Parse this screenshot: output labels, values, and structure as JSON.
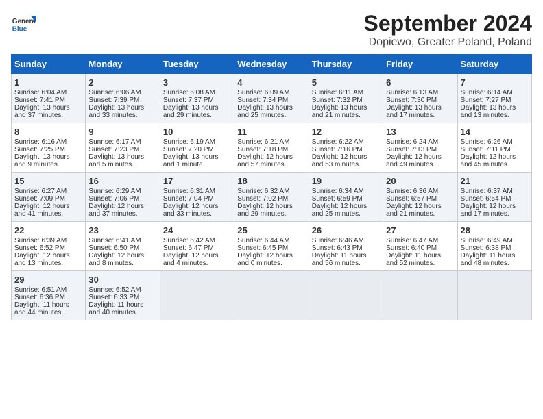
{
  "logo": {
    "general": "General",
    "blue": "Blue"
  },
  "title": "September 2024",
  "subtitle": "Dopiewo, Greater Poland, Poland",
  "weekdays": [
    "Sunday",
    "Monday",
    "Tuesday",
    "Wednesday",
    "Thursday",
    "Friday",
    "Saturday"
  ],
  "weeks": [
    [
      {
        "day": 1,
        "lines": [
          "Sunrise: 6:04 AM",
          "Sunset: 7:41 PM",
          "Daylight: 13 hours",
          "and 37 minutes."
        ]
      },
      {
        "day": 2,
        "lines": [
          "Sunrise: 6:06 AM",
          "Sunset: 7:39 PM",
          "Daylight: 13 hours",
          "and 33 minutes."
        ]
      },
      {
        "day": 3,
        "lines": [
          "Sunrise: 6:08 AM",
          "Sunset: 7:37 PM",
          "Daylight: 13 hours",
          "and 29 minutes."
        ]
      },
      {
        "day": 4,
        "lines": [
          "Sunrise: 6:09 AM",
          "Sunset: 7:34 PM",
          "Daylight: 13 hours",
          "and 25 minutes."
        ]
      },
      {
        "day": 5,
        "lines": [
          "Sunrise: 6:11 AM",
          "Sunset: 7:32 PM",
          "Daylight: 13 hours",
          "and 21 minutes."
        ]
      },
      {
        "day": 6,
        "lines": [
          "Sunrise: 6:13 AM",
          "Sunset: 7:30 PM",
          "Daylight: 13 hours",
          "and 17 minutes."
        ]
      },
      {
        "day": 7,
        "lines": [
          "Sunrise: 6:14 AM",
          "Sunset: 7:27 PM",
          "Daylight: 13 hours",
          "and 13 minutes."
        ]
      }
    ],
    [
      {
        "day": 8,
        "lines": [
          "Sunrise: 6:16 AM",
          "Sunset: 7:25 PM",
          "Daylight: 13 hours",
          "and 9 minutes."
        ]
      },
      {
        "day": 9,
        "lines": [
          "Sunrise: 6:17 AM",
          "Sunset: 7:23 PM",
          "Daylight: 13 hours",
          "and 5 minutes."
        ]
      },
      {
        "day": 10,
        "lines": [
          "Sunrise: 6:19 AM",
          "Sunset: 7:20 PM",
          "Daylight: 13 hours",
          "and 1 minute."
        ]
      },
      {
        "day": 11,
        "lines": [
          "Sunrise: 6:21 AM",
          "Sunset: 7:18 PM",
          "Daylight: 12 hours",
          "and 57 minutes."
        ]
      },
      {
        "day": 12,
        "lines": [
          "Sunrise: 6:22 AM",
          "Sunset: 7:16 PM",
          "Daylight: 12 hours",
          "and 53 minutes."
        ]
      },
      {
        "day": 13,
        "lines": [
          "Sunrise: 6:24 AM",
          "Sunset: 7:13 PM",
          "Daylight: 12 hours",
          "and 49 minutes."
        ]
      },
      {
        "day": 14,
        "lines": [
          "Sunrise: 6:26 AM",
          "Sunset: 7:11 PM",
          "Daylight: 12 hours",
          "and 45 minutes."
        ]
      }
    ],
    [
      {
        "day": 15,
        "lines": [
          "Sunrise: 6:27 AM",
          "Sunset: 7:09 PM",
          "Daylight: 12 hours",
          "and 41 minutes."
        ]
      },
      {
        "day": 16,
        "lines": [
          "Sunrise: 6:29 AM",
          "Sunset: 7:06 PM",
          "Daylight: 12 hours",
          "and 37 minutes."
        ]
      },
      {
        "day": 17,
        "lines": [
          "Sunrise: 6:31 AM",
          "Sunset: 7:04 PM",
          "Daylight: 12 hours",
          "and 33 minutes."
        ]
      },
      {
        "day": 18,
        "lines": [
          "Sunrise: 6:32 AM",
          "Sunset: 7:02 PM",
          "Daylight: 12 hours",
          "and 29 minutes."
        ]
      },
      {
        "day": 19,
        "lines": [
          "Sunrise: 6:34 AM",
          "Sunset: 6:59 PM",
          "Daylight: 12 hours",
          "and 25 minutes."
        ]
      },
      {
        "day": 20,
        "lines": [
          "Sunrise: 6:36 AM",
          "Sunset: 6:57 PM",
          "Daylight: 12 hours",
          "and 21 minutes."
        ]
      },
      {
        "day": 21,
        "lines": [
          "Sunrise: 6:37 AM",
          "Sunset: 6:54 PM",
          "Daylight: 12 hours",
          "and 17 minutes."
        ]
      }
    ],
    [
      {
        "day": 22,
        "lines": [
          "Sunrise: 6:39 AM",
          "Sunset: 6:52 PM",
          "Daylight: 12 hours",
          "and 13 minutes."
        ]
      },
      {
        "day": 23,
        "lines": [
          "Sunrise: 6:41 AM",
          "Sunset: 6:50 PM",
          "Daylight: 12 hours",
          "and 8 minutes."
        ]
      },
      {
        "day": 24,
        "lines": [
          "Sunrise: 6:42 AM",
          "Sunset: 6:47 PM",
          "Daylight: 12 hours",
          "and 4 minutes."
        ]
      },
      {
        "day": 25,
        "lines": [
          "Sunrise: 6:44 AM",
          "Sunset: 6:45 PM",
          "Daylight: 12 hours",
          "and 0 minutes."
        ]
      },
      {
        "day": 26,
        "lines": [
          "Sunrise: 6:46 AM",
          "Sunset: 6:43 PM",
          "Daylight: 11 hours",
          "and 56 minutes."
        ]
      },
      {
        "day": 27,
        "lines": [
          "Sunrise: 6:47 AM",
          "Sunset: 6:40 PM",
          "Daylight: 11 hours",
          "and 52 minutes."
        ]
      },
      {
        "day": 28,
        "lines": [
          "Sunrise: 6:49 AM",
          "Sunset: 6:38 PM",
          "Daylight: 11 hours",
          "and 48 minutes."
        ]
      }
    ],
    [
      {
        "day": 29,
        "lines": [
          "Sunrise: 6:51 AM",
          "Sunset: 6:36 PM",
          "Daylight: 11 hours",
          "and 44 minutes."
        ]
      },
      {
        "day": 30,
        "lines": [
          "Sunrise: 6:52 AM",
          "Sunset: 6:33 PM",
          "Daylight: 11 hours",
          "and 40 minutes."
        ]
      },
      null,
      null,
      null,
      null,
      null
    ]
  ]
}
